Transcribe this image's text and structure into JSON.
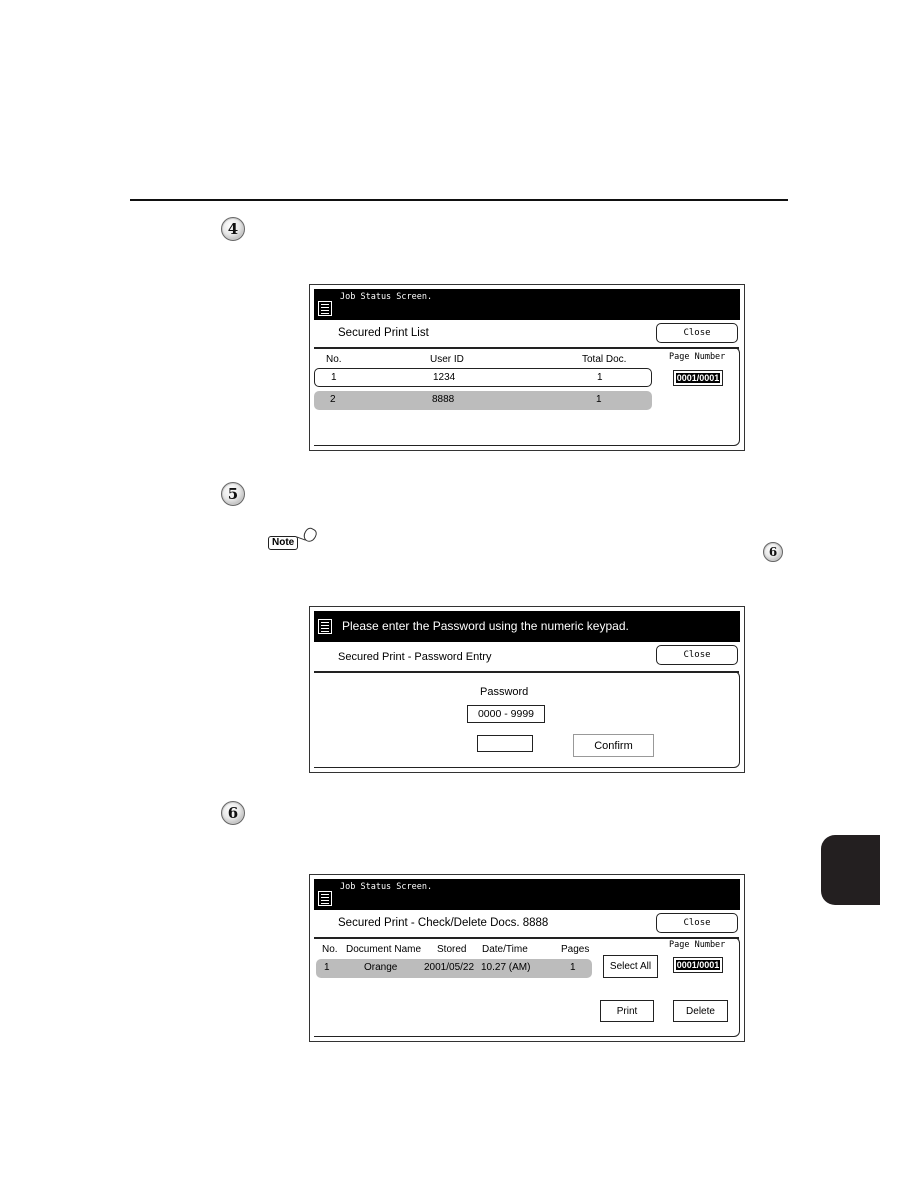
{
  "steps": [
    "4",
    "5",
    "6"
  ],
  "note": {
    "label": "Note",
    "step_ref": "6"
  },
  "screen1": {
    "header": "Job Status Screen.",
    "title": "Secured Print List",
    "close_label": "Close",
    "page_number_label": "Page Number",
    "page_number": "0001/0001",
    "columns": [
      "No.",
      "User ID",
      "Total Doc."
    ],
    "rows": [
      {
        "no": "1",
        "user_id": "1234",
        "total": "1",
        "state": "outlined"
      },
      {
        "no": "2",
        "user_id": "8888",
        "total": "1",
        "state": "selected"
      }
    ]
  },
  "screen2": {
    "header": "Please enter the Password using the numeric keypad.",
    "title": "Secured Print - Password Entry",
    "close_label": "Close",
    "password_label": "Password",
    "password_range": "0000 - 9999",
    "password_value": "",
    "confirm_label": "Confirm"
  },
  "screen3": {
    "header": "Job Status Screen.",
    "title": "Secured Print - Check/Delete Docs. 8888",
    "close_label": "Close",
    "page_number_label": "Page Number",
    "page_number": "0001/0001",
    "columns": [
      "No.",
      "Document Name",
      "Stored",
      "Date/Time",
      "Pages"
    ],
    "rows": [
      {
        "no": "1",
        "name": "Orange",
        "stored": "2001/05/22",
        "time": "10.27 (AM)",
        "pages": "1"
      }
    ],
    "select_all_label": "Select All",
    "print_label": "Print",
    "delete_label": "Delete"
  }
}
